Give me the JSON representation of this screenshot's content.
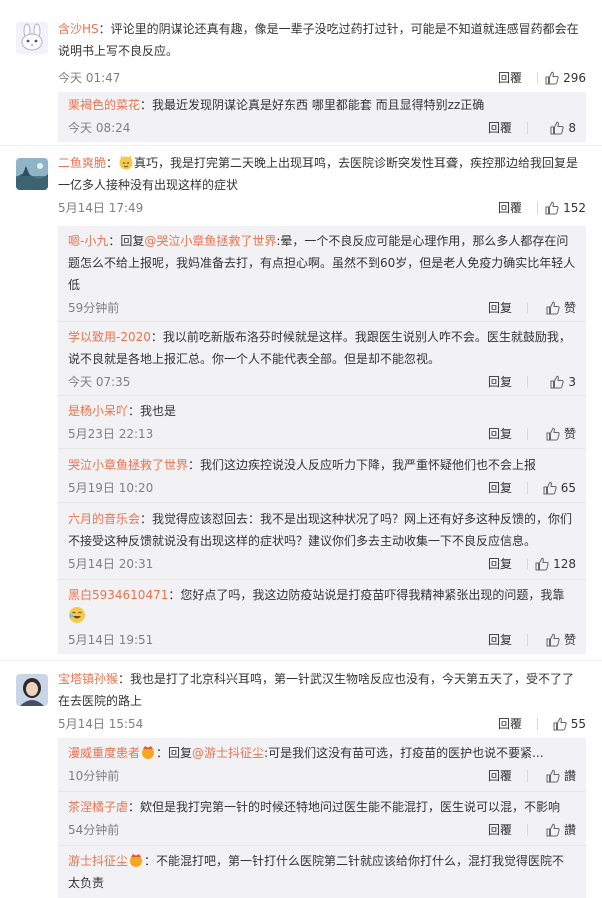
{
  "comments": [
    {
      "user": "含沙HS",
      "text": "：评论里的阴谋论还真有趣，像是一辈子没吃过药打过针，可能是不知道就连感冒药都会在说明书上写不良反应。",
      "time": "今天 01:47",
      "reply": "回覆",
      "likes": "296",
      "replies": [
        {
          "user": "栗褐色的菜花",
          "text": "：我最近发现阴谋论真是好东西 哪里都能套 而且显得特别zz正确",
          "time": "今天 08:24",
          "reply": "回覆",
          "likes": "8"
        }
      ]
    },
    {
      "user": "二鱼爽脆",
      "text": "真巧，我是打完第二天晚上出现耳鸣，去医院诊断突发性耳聋，疾控那边给我回复是一亿多人接种没有出现这样的症状",
      "time": "5月14日 17:49",
      "reply": "回覆",
      "likes": "152",
      "replies": [
        {
          "user": "嗯-小九",
          "mid": "：回复",
          "mention": "@哭泣小章鱼拯救了世界",
          "text": ":晕，一个不良反应可能是心理作用，那么多人都存在问题怎么不给上报呢，我妈准备去打，有点担心啊。虽然不到60岁，但是老人免疫力确实比年轻人低",
          "time": "59分钟前",
          "reply": "回复",
          "likes": "赞"
        },
        {
          "user": "学以致用-2020",
          "text": "：我以前吃新版布洛芬时候就是这样。我跟医生说别人咋不会。医生就鼓励我，说不良就是各地上报汇总。你一个人不能代表全部。但是却不能忽视。",
          "time": "今天 07:35",
          "reply": "回复",
          "likes": "3"
        },
        {
          "user": "是杨小呆吖",
          "text": "：我也是",
          "time": "5月23日 22:13",
          "reply": "回复",
          "likes": "赞"
        },
        {
          "user": "哭泣小章鱼拯救了世界",
          "text": "：我们这边疾控说没人反应听力下降，我严重怀疑他们也不会上报",
          "time": "5月19日 10:20",
          "reply": "回复",
          "likes": "65"
        },
        {
          "user": "六月的音乐会",
          "text": "：我觉得应该怼回去：我不是出现这种状况了吗？网上还有好多这种反馈的，你们不接受这种反馈就说没有出现这样的症状吗？建议你们多去主动收集一下不良反应信息。",
          "time": "5月14日 20:31",
          "reply": "回复",
          "likes": "128"
        },
        {
          "user": "黑白5934610471",
          "text": "：您好点了吗，我这边防疫站说是打疫苗吓得我精神紧张出现的问题，我靠",
          "time": "5月14日 19:51",
          "reply": "回复",
          "likes": "赞"
        }
      ]
    },
    {
      "user": "宝塔镇孙猴",
      "text": "：我也是打了北京科兴耳鸣，第一针武汉生物啥反应也没有，今天第五天了，受不了了在去医院的路上",
      "time": "5月14日 15:54",
      "reply": "回覆",
      "likes": "55",
      "replies": [
        {
          "user": "漫威重度患者",
          "mid": "：回复",
          "mention": "@游士抖征尘",
          "text": ":可是我们这没有苗可选，打疫苗的医护也说不要紧...",
          "time": "10分钟前",
          "reply": "回覆",
          "likes": "讚"
        },
        {
          "user": "茶涅橘子虐",
          "text": "：欸但是我打完第一针的时候还特地问过医生能不能混打，医生说可以混，不影响",
          "time": "54分钟前",
          "reply": "回覆",
          "likes": "讚"
        },
        {
          "user": "游士抖征尘",
          "text": "：不能混打吧，第一针打什么医院第二针就应该给你打什么，混打我觉得医院不太负责",
          "time": "",
          "reply": "",
          "likes": ""
        }
      ]
    }
  ],
  "colors": {
    "username": "#eb7350",
    "mention": "#eb7350",
    "text": "#333333",
    "meta": "#808080",
    "subbg": "#f2f2f5"
  },
  "icons": [
    "thumbs-up-icon",
    "avatar-bunny",
    "avatar-landscape",
    "avatar-girl",
    "cat-emoji-icon",
    "crown-emoji-icon",
    "laughing-emoji-icon"
  ]
}
